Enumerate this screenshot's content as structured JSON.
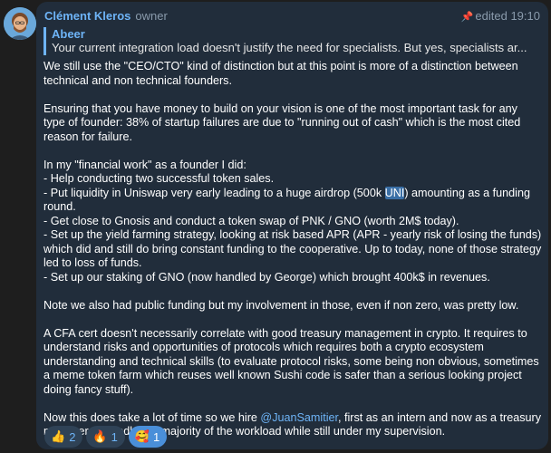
{
  "message": {
    "author": "Clément Kleros",
    "role": "owner",
    "edited_label": "edited 19:10",
    "reply": {
      "author": "Abeer",
      "text": "Your current integration load doesn't justify the need for specialists. But yes, specialists ar..."
    },
    "paragraphs": {
      "p1": "We still use the \"CEO/CTO\" kind of distinction but at this point is more of a distinction between technical and non technical founders.",
      "p2": "Ensuring that you have money to build on your vision is one of the most important task for any type of founder: 38% of startup failures are due to \"running out of cash\" which is the most cited reason for failure.",
      "p3_intro": "In my \"financial work\" as a founder I did:",
      "b1": "- Help conducting two successful token sales.",
      "b2_before": "- Put liquidity in Uniswap very early leading to a huge airdrop (500k ",
      "b2_highlight": "UNI",
      "b2_after": ") amounting as a funding round.",
      "b3": "- Get close to Gnosis and conduct a token swap of PNK / GNO (worth 2M$ today).",
      "b4": "- Set up the yield farming strategy, looking at risk based APR (APR - yearly risk of losing the funds) which did and still do bring constant funding to the cooperative. Up to today, none of those strategy led to loss of funds.",
      "b5": "- Set up our staking of GNO (now handled by George) which brought 400k$ in revenues.",
      "p4": "Note we also had public funding but my involvement in those, even if non zero, was pretty low.",
      "p5": "A CFA cert doesn't necessarily correlate with good treasury management in crypto. It requires to understand risks and opportunities of protocols which requires both a crypto ecosystem understanding and technical skills (to evaluate protocol risks, some being non obvious, sometimes a meme token farm which reuses well known Sushi code is safer than a serious looking project doing fancy stuff).",
      "p6_before": "Now this does take a lot of time so we hire ",
      "p6_mention": "@JuanSamitier",
      "p6_after": ", first as an intern and now as a treasury manager to handle the majority of the workload while still under my supervision."
    },
    "reactions": [
      {
        "emoji": "👍",
        "count": "2"
      },
      {
        "emoji": "🔥",
        "count": "1"
      },
      {
        "emoji": "🥰",
        "count": "1"
      }
    ]
  }
}
